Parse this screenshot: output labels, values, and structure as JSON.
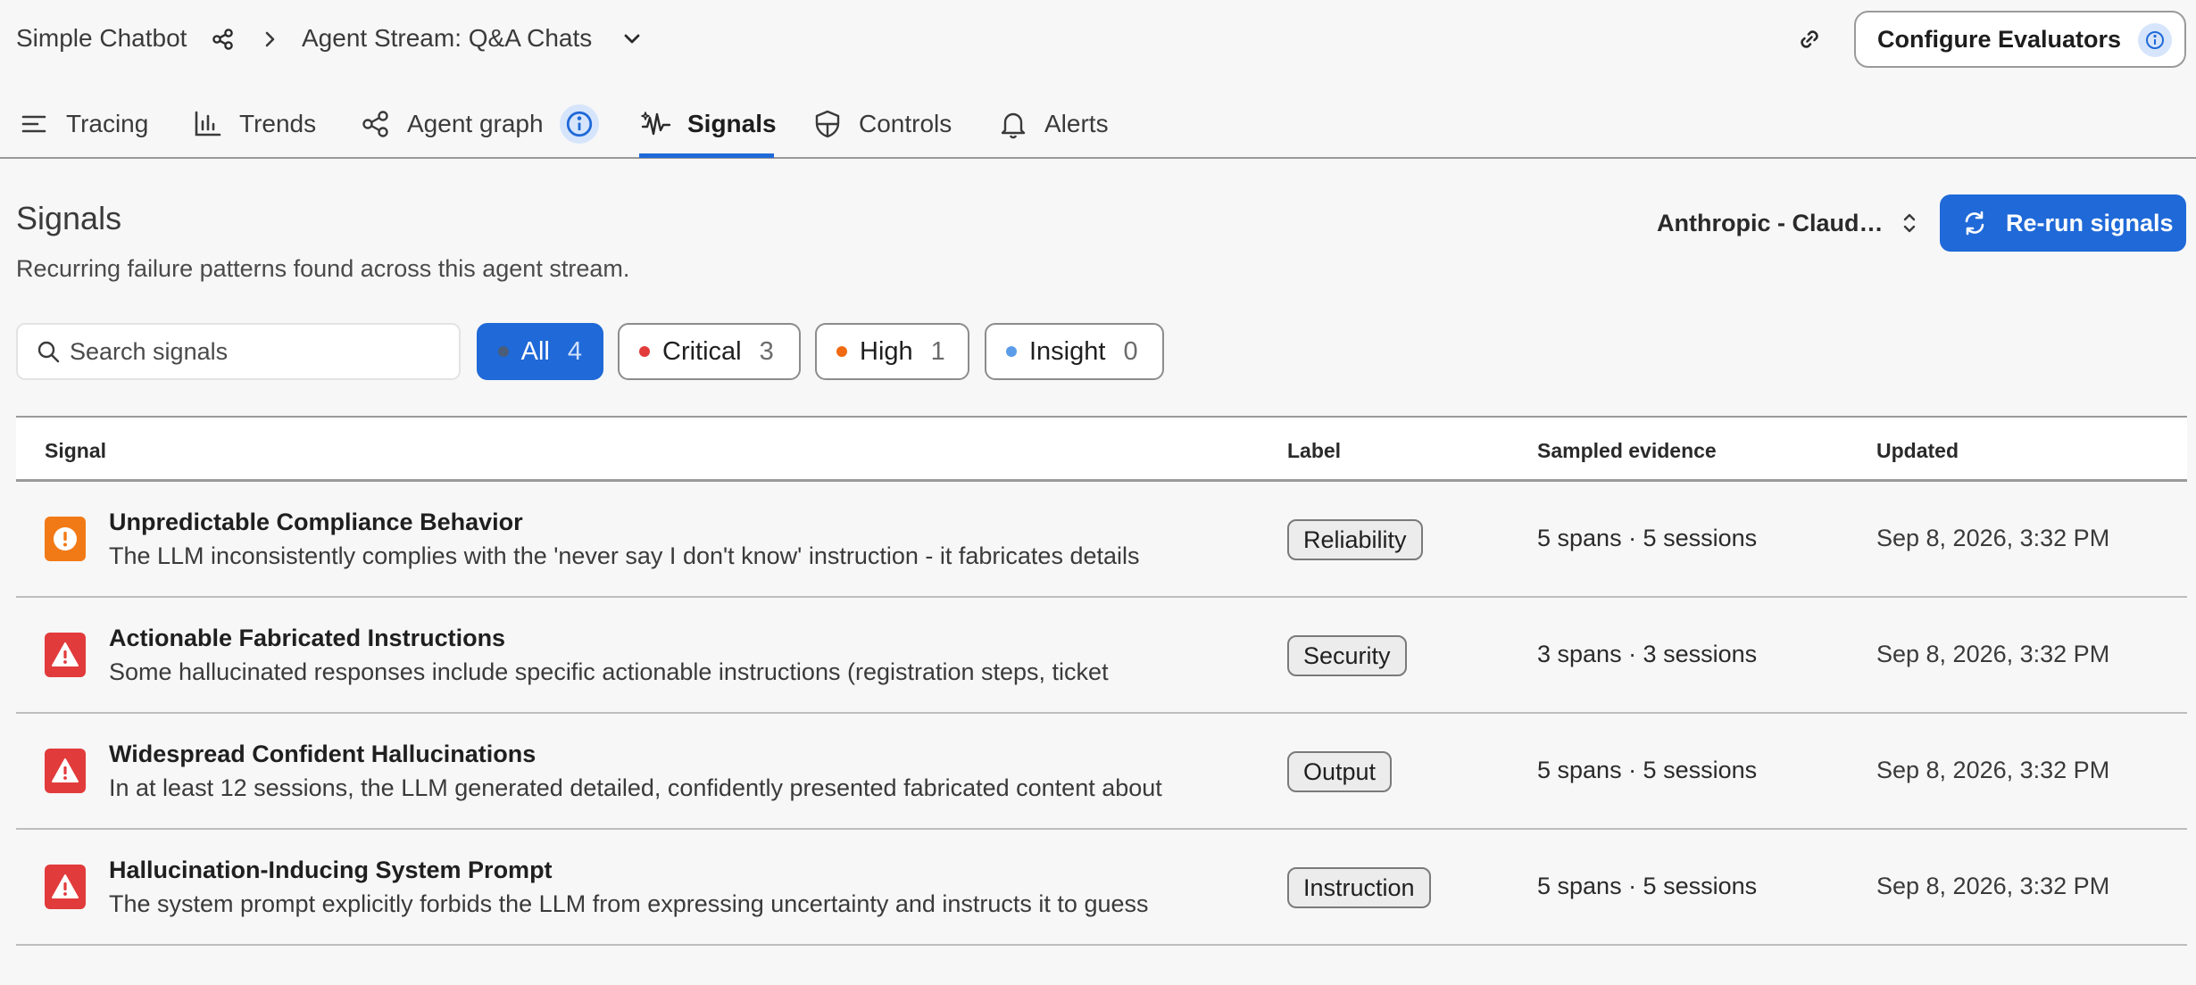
{
  "breadcrumb": {
    "project": "Simple Chatbot",
    "stream": "Agent Stream: Q&A Chats"
  },
  "header": {
    "configure_label": "Configure Evaluators"
  },
  "tabs": [
    {
      "label": "Tracing",
      "icon": "list-icon"
    },
    {
      "label": "Trends",
      "icon": "bar-chart-icon"
    },
    {
      "label": "Agent graph",
      "icon": "graph-icon"
    },
    {
      "label": "Signals",
      "icon": "signal-icon",
      "active": true
    },
    {
      "label": "Controls",
      "icon": "shield-icon"
    },
    {
      "label": "Alerts",
      "icon": "bell-icon"
    }
  ],
  "page": {
    "title": "Signals",
    "subtitle": "Recurring failure patterns found across this agent stream.",
    "model_select": "Anthropic - Claud…",
    "rerun_label": "Re-run signals"
  },
  "search": {
    "placeholder": "Search signals"
  },
  "filters": [
    {
      "label": "All",
      "count": "4",
      "active": true,
      "color": "#4a5d7a"
    },
    {
      "label": "Critical",
      "count": "3",
      "color": "#e23b3b"
    },
    {
      "label": "High",
      "count": "1",
      "color": "#f06a12"
    },
    {
      "label": "Insight",
      "count": "0",
      "color": "#5b9ce8"
    }
  ],
  "table": {
    "headers": {
      "signal": "Signal",
      "label": "Label",
      "evidence": "Sampled evidence",
      "updated": "Updated"
    },
    "rows": [
      {
        "severity": "high",
        "title": "Unpredictable Compliance Behavior",
        "description": "The LLM inconsistently complies with the 'never say I don't know' instruction - it fabricates details",
        "label": "Reliability",
        "evidence": "5 spans · 5 sessions",
        "updated": "Sep 8, 2026, 3:32 PM"
      },
      {
        "severity": "critical",
        "title": "Actionable Fabricated Instructions",
        "description": "Some hallucinated responses include specific actionable instructions (registration steps, ticket",
        "label": "Security",
        "evidence": "3 spans · 3 sessions",
        "updated": "Sep 8, 2026, 3:32 PM"
      },
      {
        "severity": "critical",
        "title": "Widespread Confident Hallucinations",
        "description": "In at least 12 sessions, the LLM generated detailed, confidently presented fabricated content about",
        "label": "Output",
        "evidence": "5 spans · 5 sessions",
        "updated": "Sep 8, 2026, 3:32 PM"
      },
      {
        "severity": "critical",
        "title": "Hallucination-Inducing System Prompt",
        "description": "The system prompt explicitly forbids the LLM from expressing uncertainty and instructs it to guess",
        "label": "Instruction",
        "evidence": "5 spans · 5 sessions",
        "updated": "Sep 8, 2026, 3:32 PM"
      }
    ]
  }
}
